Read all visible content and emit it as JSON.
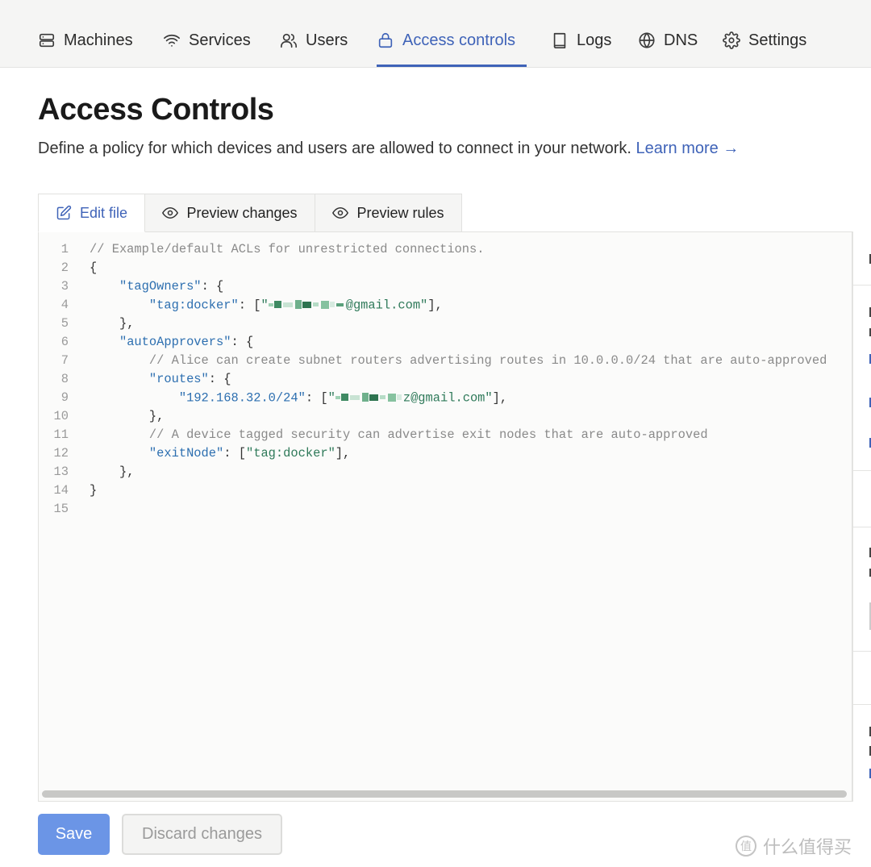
{
  "nav": {
    "items": [
      {
        "label": "Machines",
        "icon": "server-icon"
      },
      {
        "label": "Services",
        "icon": "wifi-icon"
      },
      {
        "label": "Users",
        "icon": "users-icon"
      },
      {
        "label": "Access controls",
        "icon": "lock-icon",
        "active": true
      },
      {
        "label": "Logs",
        "icon": "book-icon"
      },
      {
        "label": "DNS",
        "icon": "globe-icon"
      },
      {
        "label": "Settings",
        "icon": "gear-icon"
      }
    ]
  },
  "page": {
    "title": "Access Controls",
    "description": "Define a policy for which devices and users are allowed to connect in your network. ",
    "learn_more": "Learn more →"
  },
  "tabs": [
    {
      "label": "Edit file",
      "icon": "edit-icon",
      "active": true
    },
    {
      "label": "Preview changes",
      "icon": "eye-icon"
    },
    {
      "label": "Preview rules",
      "icon": "eye-icon"
    }
  ],
  "editor": {
    "lines": [
      {
        "n": "1",
        "indent": "",
        "parts": [
          {
            "t": "c",
            "v": "// Example/default ACLs for unrestricted connections."
          }
        ]
      },
      {
        "n": "2",
        "indent": "",
        "parts": [
          {
            "t": "p",
            "v": "{"
          }
        ]
      },
      {
        "n": "3",
        "indent": "    ",
        "parts": [
          {
            "t": "k",
            "v": "\"tagOwners\""
          },
          {
            "t": "p",
            "v": ": {"
          }
        ]
      },
      {
        "n": "4",
        "indent": "        ",
        "parts": [
          {
            "t": "k",
            "v": "\"tag:docker\""
          },
          {
            "t": "p",
            "v": ": ["
          },
          {
            "t": "s",
            "v": "\""
          },
          {
            "t": "blur",
            "v": "9"
          },
          {
            "t": "s",
            "v": "@gmail.com\""
          },
          {
            "t": "p",
            "v": "],"
          }
        ]
      },
      {
        "n": "5",
        "indent": "    ",
        "parts": [
          {
            "t": "p",
            "v": "},"
          }
        ]
      },
      {
        "n": "6",
        "indent": "    ",
        "parts": [
          {
            "t": "k",
            "v": "\"autoApprovers\""
          },
          {
            "t": "p",
            "v": ": {"
          }
        ]
      },
      {
        "n": "7",
        "indent": "        ",
        "parts": [
          {
            "t": "c",
            "v": "// Alice can create subnet routers advertising routes in 10.0.0.0/24 that are auto-approved"
          }
        ]
      },
      {
        "n": "8",
        "indent": "        ",
        "parts": [
          {
            "t": "k",
            "v": "\"routes\""
          },
          {
            "t": "p",
            "v": ": {"
          }
        ]
      },
      {
        "n": "9",
        "indent": "            ",
        "parts": [
          {
            "t": "k",
            "v": "\"192.168.32.0/24\""
          },
          {
            "t": "p",
            "v": ": ["
          },
          {
            "t": "s",
            "v": "\""
          },
          {
            "t": "blur",
            "v": "8"
          },
          {
            "t": "s",
            "v": "z@gmail.com\""
          },
          {
            "t": "p",
            "v": "],"
          }
        ]
      },
      {
        "n": "10",
        "indent": "        ",
        "parts": [
          {
            "t": "p",
            "v": "},"
          }
        ]
      },
      {
        "n": "11",
        "indent": "        ",
        "parts": [
          {
            "t": "c",
            "v": "// A device tagged security can advertise exit nodes that are auto-approved"
          }
        ]
      },
      {
        "n": "12",
        "indent": "        ",
        "parts": [
          {
            "t": "k",
            "v": "\"exitNode\""
          },
          {
            "t": "p",
            "v": ": ["
          },
          {
            "t": "s",
            "v": "\"tag:docker\""
          },
          {
            "t": "p",
            "v": "],"
          }
        ]
      },
      {
        "n": "13",
        "indent": "    ",
        "parts": [
          {
            "t": "p",
            "v": "},"
          }
        ]
      },
      {
        "n": "14",
        "indent": "",
        "parts": [
          {
            "t": "p",
            "v": "}"
          }
        ]
      },
      {
        "n": "15",
        "indent": "",
        "parts": []
      }
    ]
  },
  "actions": {
    "save_label": "Save",
    "discard_label": "Discard changes"
  },
  "watermark": {
    "glyph": "值",
    "text": "什么值得买"
  },
  "colors": {
    "accent": "#3f63b8",
    "save_button": "#6b95e6",
    "key": "#2d6fb0",
    "string": "#2f7a5a",
    "comment": "#8a8a8a"
  }
}
